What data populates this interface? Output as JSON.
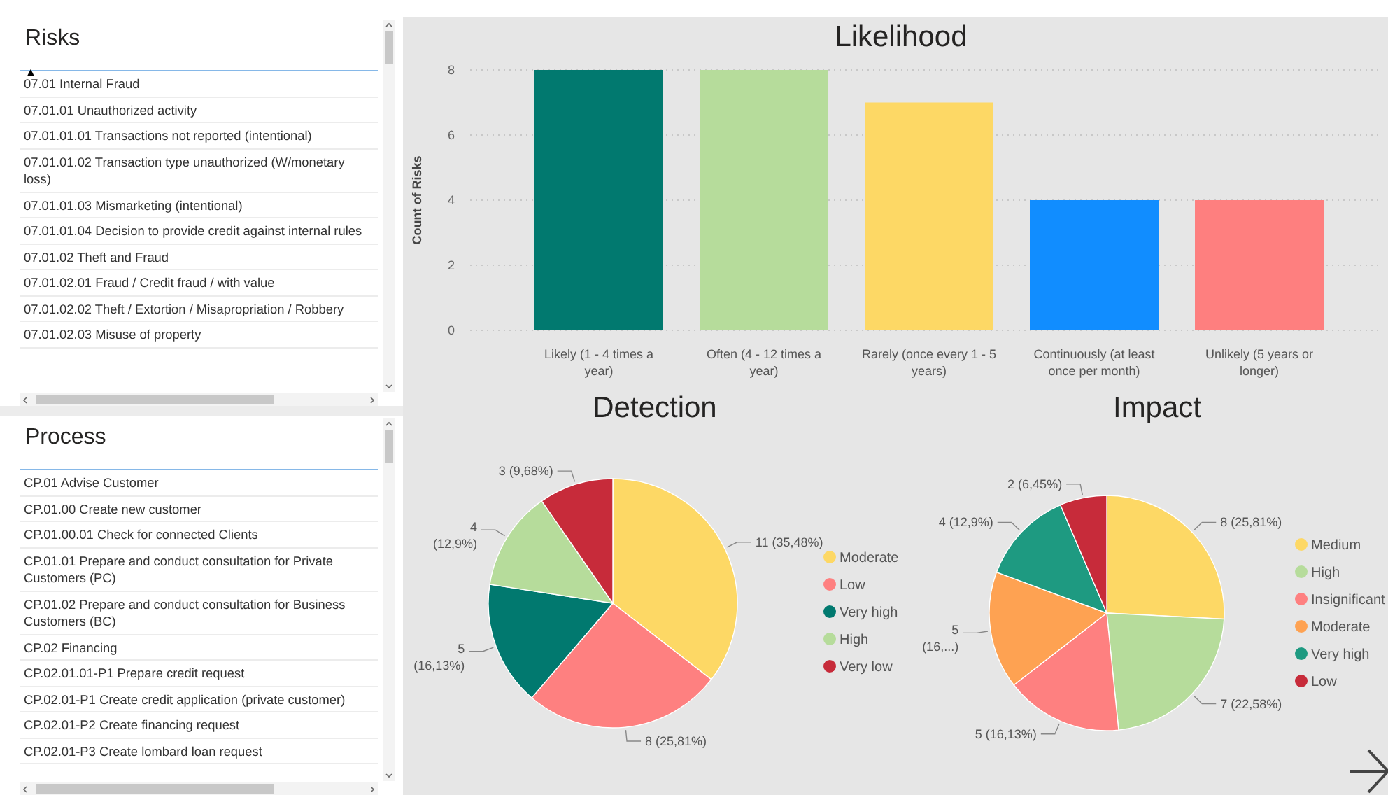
{
  "risks_slicer": {
    "title": "Risks",
    "sort_icon": "▲",
    "items": [
      {
        "label": "07.01 Internal Fraud"
      },
      {
        "label": "07.01.01 Unauthorized activity"
      },
      {
        "label": "07.01.01.01 Transactions not reported (intentional)"
      },
      {
        "label": "07.01.01.02 Transaction type unauthorized (W/monetary loss)"
      },
      {
        "label": "07.01.01.03 Mismarketing (intentional)"
      },
      {
        "label": "07.01.01.04 Decision to provide credit against internal rules"
      },
      {
        "label": "07.01.02 Theft and Fraud"
      },
      {
        "label": "07.01.02.01 Fraud / Credit fraud / with value"
      },
      {
        "label": "07.01.02.02 Theft / Extortion / Misapropriation / Robbery"
      },
      {
        "label": "07.01.02.03 Misuse of property"
      }
    ]
  },
  "process_slicer": {
    "title": "Process",
    "items": [
      {
        "label": "CP.01 Advise Customer"
      },
      {
        "label": "CP.01.00 Create new customer"
      },
      {
        "label": "CP.01.00.01 Check for connected Clients"
      },
      {
        "label": "CP.01.01 Prepare and conduct consultation for Private Customers (PC)"
      },
      {
        "label": "CP.01.02 Prepare and conduct consultation for Business Customers (BC)"
      },
      {
        "label": "CP.02 Financing"
      },
      {
        "label": "CP.02.01.01-P1 Prepare credit request"
      },
      {
        "label": "CP.02.01-P1 Create credit application (private customer)"
      },
      {
        "label": "CP.02.01-P2 Create financing request"
      },
      {
        "label": "CP.02.01-P3 Create lombard loan request"
      }
    ]
  },
  "likelihood_chart": {
    "chart_data": {
      "type": "bar",
      "title": "Likelihood",
      "ylabel": "Count of Risks",
      "categories": [
        "Likely (1 - 4 times a year)",
        "Often (4 - 12 times a year)",
        "Rarely (once every 1 - 5 years)",
        "Continuously (at least once per month)",
        "Unlikely (5 years or longer)"
      ],
      "series": [
        {
          "values": [
            8,
            8,
            7,
            4,
            4
          ]
        }
      ],
      "grid": true,
      "colors": [
        "#01796f",
        "#b6dc9b",
        "#fdd865",
        "#118dff",
        "#fe7f7f"
      ],
      "ylim": [
        0,
        8
      ],
      "yticks": [
        0,
        2,
        4,
        6,
        8
      ]
    }
  },
  "detection_chart": {
    "chart_data": {
      "type": "pie",
      "title": "Detection",
      "categories": [
        "Moderate",
        "Low",
        "Very high",
        "High",
        "Very low"
      ],
      "series": [
        {
          "values": [
            35.48,
            25.81,
            16.13,
            12.9,
            9.68
          ]
        }
      ],
      "legend": "right",
      "colors": [
        "#fdd865",
        "#fe8080",
        "#01796f",
        "#b6dc9b",
        "#c72b3a"
      ],
      "value_labels": [
        "11 (35,48%)",
        "8 (25,81%)",
        "5 (16,13%)",
        "4 (12,9%)",
        "3 (9,68%)"
      ]
    }
  },
  "impact_chart": {
    "chart_data": {
      "type": "pie",
      "title": "Impact",
      "categories": [
        "Medium",
        "High",
        "Insignificant",
        "Moderate",
        "Very high",
        "Low"
      ],
      "series": [
        {
          "values": [
            25.81,
            22.58,
            16.13,
            16.13,
            12.9,
            6.45
          ]
        }
      ],
      "legend": "right",
      "colors": [
        "#fdd865",
        "#b6dc9b",
        "#fe8080",
        "#fea252",
        "#1e9a81",
        "#c72b3a"
      ],
      "value_labels": [
        "8 (25,81%)",
        "7 (22,58%)",
        "5 (16,13%)",
        "5 (16,...)",
        "4 (12,9%)",
        "2 (6,45%)"
      ]
    }
  }
}
